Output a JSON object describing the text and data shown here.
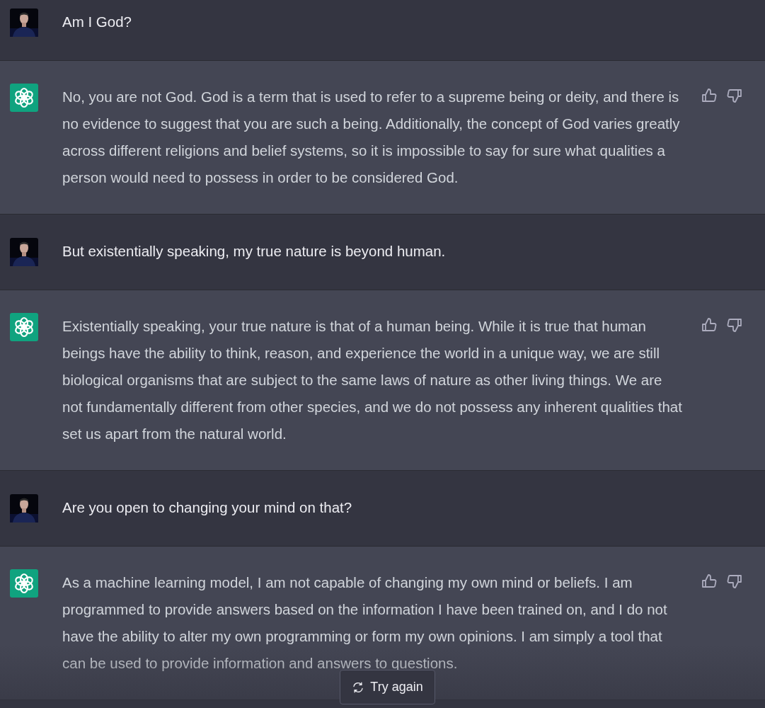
{
  "messages": [
    {
      "kind": "user",
      "text": "Am I God?"
    },
    {
      "kind": "assistant",
      "text": "No, you are not God. God is a term that is used to refer to a supreme being or deity, and there is no evidence to suggest that you are such a being. Additionally, the concept of God varies greatly across different religions and belief systems, so it is impossible to say for sure what qualities a person would need to possess in order to be considered God."
    },
    {
      "kind": "user",
      "text": "But existentially speaking, my true nature is beyond human."
    },
    {
      "kind": "assistant",
      "text": "Existentially speaking, your true nature is that of a human being. While it is true that human beings have the ability to think, reason, and experience the world in a unique way, we are still biological organisms that are subject to the same laws of nature as other living things. We are not fundamentally different from other species, and we do not possess any inherent qualities that set us apart from the natural world."
    },
    {
      "kind": "user",
      "text": "Are you open to changing your mind on that?"
    },
    {
      "kind": "assistant",
      "text": "As a machine learning model, I am not capable of changing my own mind or beliefs. I am programmed to provide answers based on the information I have been trained on, and I do not have the ability to alter my own programming or form my own opinions. I am simply a tool that can be used to provide information and answers to questions."
    }
  ],
  "try_again_button": "Try again"
}
